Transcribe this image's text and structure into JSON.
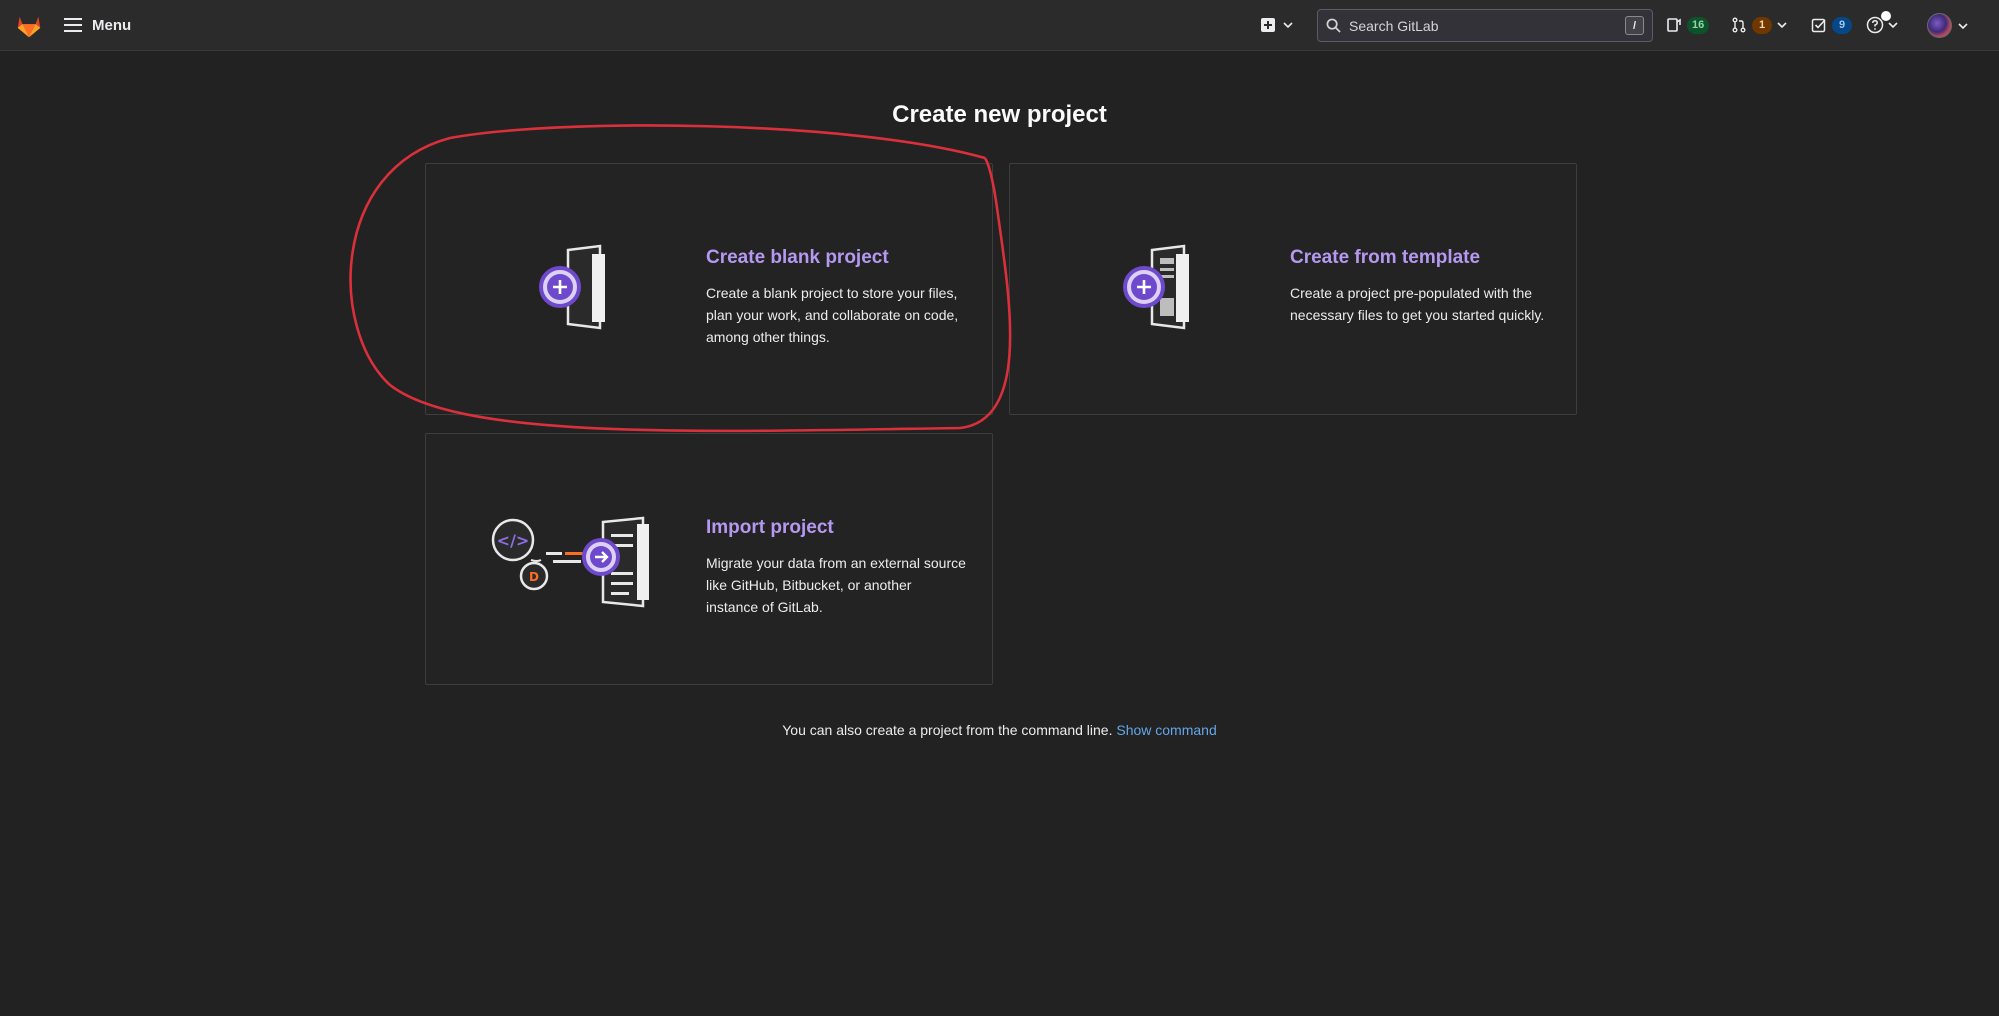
{
  "topbar": {
    "menu_label": "Menu",
    "search_placeholder": "Search GitLab",
    "search_shortcut": "/",
    "issues_count": "16",
    "merge_requests_count": "1",
    "todos_count": "9",
    "icons": {
      "logo": "gitlab-tanuki-icon",
      "menu": "hamburger-icon",
      "new": "plus-square-icon",
      "search": "search-icon",
      "issues": "issues-icon",
      "merge_requests": "merge-request-icon",
      "todos": "todo-check-icon",
      "help": "question-circle-icon",
      "dropdown": "chevron-down-icon"
    }
  },
  "page": {
    "title": "Create new project",
    "cards": {
      "blank": {
        "title": "Create blank project",
        "description": "Create a blank project to store your files, plan your work, and collaborate on code, among other things."
      },
      "template": {
        "title": "Create from template",
        "description": "Create a project pre-populated with the necessary files to get you started quickly."
      },
      "import": {
        "title": "Import project",
        "description": "Migrate your data from an external source like GitHub, Bitbucket, or another instance of GitLab."
      }
    },
    "cli_text": "You can also create a project from the command line.",
    "cli_link": "Show command"
  },
  "colors": {
    "background": "#222222",
    "accent_purple": "#b598f0",
    "link_blue": "#63a6e9",
    "annotation_red": "#d9303b",
    "badge_green": "#0d532a",
    "badge_orange": "#703800",
    "badge_blue": "#064787"
  }
}
